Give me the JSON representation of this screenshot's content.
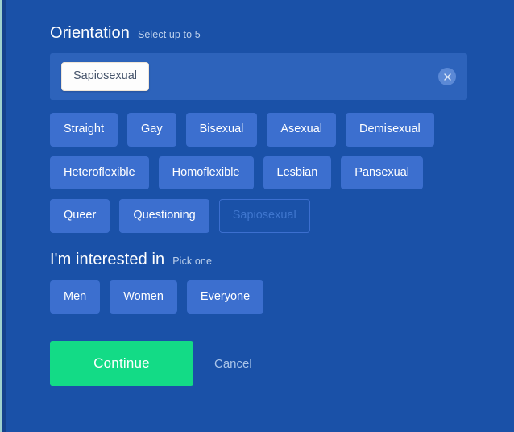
{
  "theme": {
    "background": "#1a51a8",
    "field_background": "#2d63bb",
    "chip_background": "#3c6fcf",
    "chip_disabled_border": "#3c6fcf",
    "accent_green": "#13db86",
    "token_background": "#fdfdfd",
    "token_text": "#46546b",
    "hint_text": "#bcd0ec",
    "cancel_text": "#a9c4e9",
    "edge_strip": "#9fd2cf"
  },
  "orientation": {
    "title": "Orientation",
    "hint": "Select up to 5",
    "field": {
      "selected_tokens": [
        {
          "label": "Sapiosexual"
        }
      ],
      "clear_icon": "clear-circle-icon"
    },
    "option_rows": [
      [
        {
          "label": "Straight",
          "disabled": false
        },
        {
          "label": "Gay",
          "disabled": false
        },
        {
          "label": "Bisexual",
          "disabled": false
        },
        {
          "label": "Asexual",
          "disabled": false
        },
        {
          "label": "Demisexual",
          "disabled": false
        }
      ],
      [
        {
          "label": "Heteroflexible",
          "disabled": false
        },
        {
          "label": "Homoflexible",
          "disabled": false
        },
        {
          "label": "Lesbian",
          "disabled": false
        },
        {
          "label": "Pansexual",
          "disabled": false
        }
      ],
      [
        {
          "label": "Queer",
          "disabled": false
        },
        {
          "label": "Questioning",
          "disabled": false
        },
        {
          "label": "Sapiosexual",
          "disabled": true
        }
      ]
    ]
  },
  "interest": {
    "title": "I'm interested in",
    "hint": "Pick one",
    "option_rows": [
      [
        {
          "label": "Men",
          "disabled": false
        },
        {
          "label": "Women",
          "disabled": false
        },
        {
          "label": "Everyone",
          "disabled": false
        }
      ]
    ]
  },
  "actions": {
    "continue_label": "Continue",
    "cancel_label": "Cancel"
  }
}
